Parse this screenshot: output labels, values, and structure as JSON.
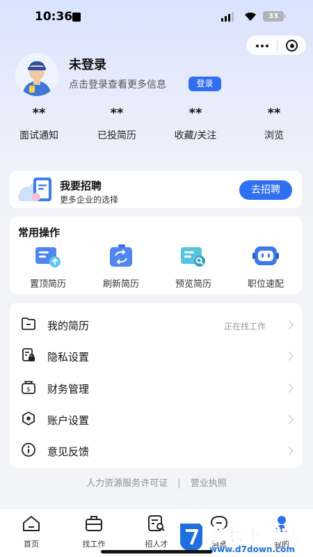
{
  "status_bar": {
    "time": "10:36",
    "battery": "33"
  },
  "profile": {
    "name": "未登录",
    "subtitle": "点击登录查看更多信息",
    "login_label": "登录"
  },
  "stats": [
    {
      "value": "**",
      "label": "面试通知"
    },
    {
      "value": "**",
      "label": "已投简历"
    },
    {
      "value": "**",
      "label": "收藏/关注"
    },
    {
      "value": "**",
      "label": "浏览"
    }
  ],
  "recruit": {
    "title": "我要招聘",
    "subtitle": "更多企业的选择",
    "button": "去招聘"
  },
  "ops": {
    "title": "常用操作",
    "items": [
      {
        "label": "置顶简历",
        "icon": "resume-top-icon"
      },
      {
        "label": "刷新简历",
        "icon": "refresh-resume-icon"
      },
      {
        "label": "预览简历",
        "icon": "preview-resume-icon"
      },
      {
        "label": "职位速配",
        "icon": "job-match-icon"
      }
    ]
  },
  "menu": [
    {
      "label": "我的简历",
      "status": "正在找工作",
      "icon": "folder-icon"
    },
    {
      "label": "隐私设置",
      "status": "",
      "icon": "privacy-lock-icon"
    },
    {
      "label": "财务管理",
      "status": "",
      "icon": "wallet-icon"
    },
    {
      "label": "账户设置",
      "status": "",
      "icon": "hexagon-settings-icon"
    },
    {
      "label": "意见反馈",
      "status": "",
      "icon": "info-circle-icon"
    }
  ],
  "footer": {
    "license": "人力资源服务许可证",
    "separator": "|",
    "business": "营业执照"
  },
  "tabs": [
    {
      "label": "首页",
      "icon": "home-icon"
    },
    {
      "label": "找工作",
      "icon": "briefcase-icon"
    },
    {
      "label": "招人才",
      "icon": "search-document-icon"
    },
    {
      "label": "消息",
      "icon": "message-icon"
    },
    {
      "label": "我的",
      "icon": "user-icon"
    }
  ],
  "watermark": {
    "title": "第七下载站",
    "url": "www.d7down.com"
  },
  "colors": {
    "accent": "#2f6ff2",
    "background": "#f3f4f8"
  }
}
